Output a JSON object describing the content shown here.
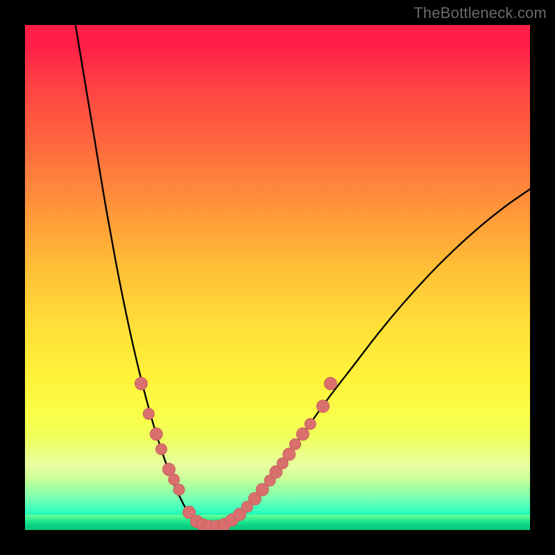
{
  "watermark": "TheBottleneck.com",
  "colors": {
    "background": "#000000",
    "curve": "#000000",
    "dot_fill": "#d9706e",
    "dot_stroke": "#c75f5d",
    "gradient_stops": [
      "#ff1e46",
      "#ff6a3e",
      "#ffe038",
      "#f8ff4a",
      "#00d88e"
    ]
  },
  "chart_data": {
    "type": "line",
    "title": "",
    "xlabel": "",
    "ylabel": "",
    "xlim": [
      0,
      100
    ],
    "ylim": [
      0,
      100
    ],
    "grid": false,
    "legend": false,
    "curve_description": "Asymmetric V-shaped bottleneck curve; steep descent on the left, minimum plateau near x≈34–40, gentler rise to the right.",
    "curve_points": [
      {
        "x": 10.0,
        "y": 100.0
      },
      {
        "x": 12.0,
        "y": 88.0
      },
      {
        "x": 14.0,
        "y": 76.0
      },
      {
        "x": 16.0,
        "y": 64.0
      },
      {
        "x": 18.0,
        "y": 53.0
      },
      {
        "x": 20.0,
        "y": 43.0
      },
      {
        "x": 22.0,
        "y": 34.0
      },
      {
        "x": 24.0,
        "y": 26.0
      },
      {
        "x": 26.0,
        "y": 19.0
      },
      {
        "x": 28.0,
        "y": 13.0
      },
      {
        "x": 30.0,
        "y": 8.0
      },
      {
        "x": 32.0,
        "y": 4.0
      },
      {
        "x": 34.0,
        "y": 1.5
      },
      {
        "x": 36.0,
        "y": 0.6
      },
      {
        "x": 38.0,
        "y": 0.6
      },
      {
        "x": 40.0,
        "y": 1.3
      },
      {
        "x": 43.0,
        "y": 3.5
      },
      {
        "x": 46.0,
        "y": 7.0
      },
      {
        "x": 50.0,
        "y": 12.0
      },
      {
        "x": 55.0,
        "y": 19.0
      },
      {
        "x": 60.0,
        "y": 26.0
      },
      {
        "x": 65.0,
        "y": 32.5
      },
      {
        "x": 70.0,
        "y": 39.0
      },
      {
        "x": 75.0,
        "y": 45.0
      },
      {
        "x": 80.0,
        "y": 50.5
      },
      {
        "x": 85.0,
        "y": 55.5
      },
      {
        "x": 90.0,
        "y": 60.0
      },
      {
        "x": 95.0,
        "y": 64.0
      },
      {
        "x": 100.0,
        "y": 67.5
      }
    ],
    "dots": [
      {
        "x": 23.0,
        "y": 29,
        "r": 9
      },
      {
        "x": 24.5,
        "y": 23,
        "r": 8
      },
      {
        "x": 26.0,
        "y": 19,
        "r": 9
      },
      {
        "x": 27.0,
        "y": 16,
        "r": 8
      },
      {
        "x": 28.5,
        "y": 12,
        "r": 9
      },
      {
        "x": 29.5,
        "y": 10,
        "r": 8
      },
      {
        "x": 30.5,
        "y": 8,
        "r": 8
      },
      {
        "x": 32.5,
        "y": 3.5,
        "r": 9
      },
      {
        "x": 34.0,
        "y": 1.7,
        "r": 9
      },
      {
        "x": 35.2,
        "y": 1.0,
        "r": 9
      },
      {
        "x": 36.5,
        "y": 0.7,
        "r": 9
      },
      {
        "x": 38.0,
        "y": 0.7,
        "r": 9
      },
      {
        "x": 39.5,
        "y": 1.1,
        "r": 9
      },
      {
        "x": 41.0,
        "y": 2.0,
        "r": 9
      },
      {
        "x": 42.5,
        "y": 3.1,
        "r": 9
      },
      {
        "x": 44.0,
        "y": 4.6,
        "r": 8
      },
      {
        "x": 45.5,
        "y": 6.2,
        "r": 9
      },
      {
        "x": 47.0,
        "y": 8.0,
        "r": 9
      },
      {
        "x": 48.5,
        "y": 9.8,
        "r": 8
      },
      {
        "x": 49.7,
        "y": 11.5,
        "r": 9
      },
      {
        "x": 51.0,
        "y": 13.2,
        "r": 8
      },
      {
        "x": 52.3,
        "y": 15.0,
        "r": 9
      },
      {
        "x": 53.5,
        "y": 17.0,
        "r": 8
      },
      {
        "x": 55.0,
        "y": 19.0,
        "r": 9
      },
      {
        "x": 56.5,
        "y": 21.0,
        "r": 8
      },
      {
        "x": 59.0,
        "y": 24.5,
        "r": 9
      },
      {
        "x": 60.5,
        "y": 29.0,
        "r": 9
      }
    ]
  }
}
